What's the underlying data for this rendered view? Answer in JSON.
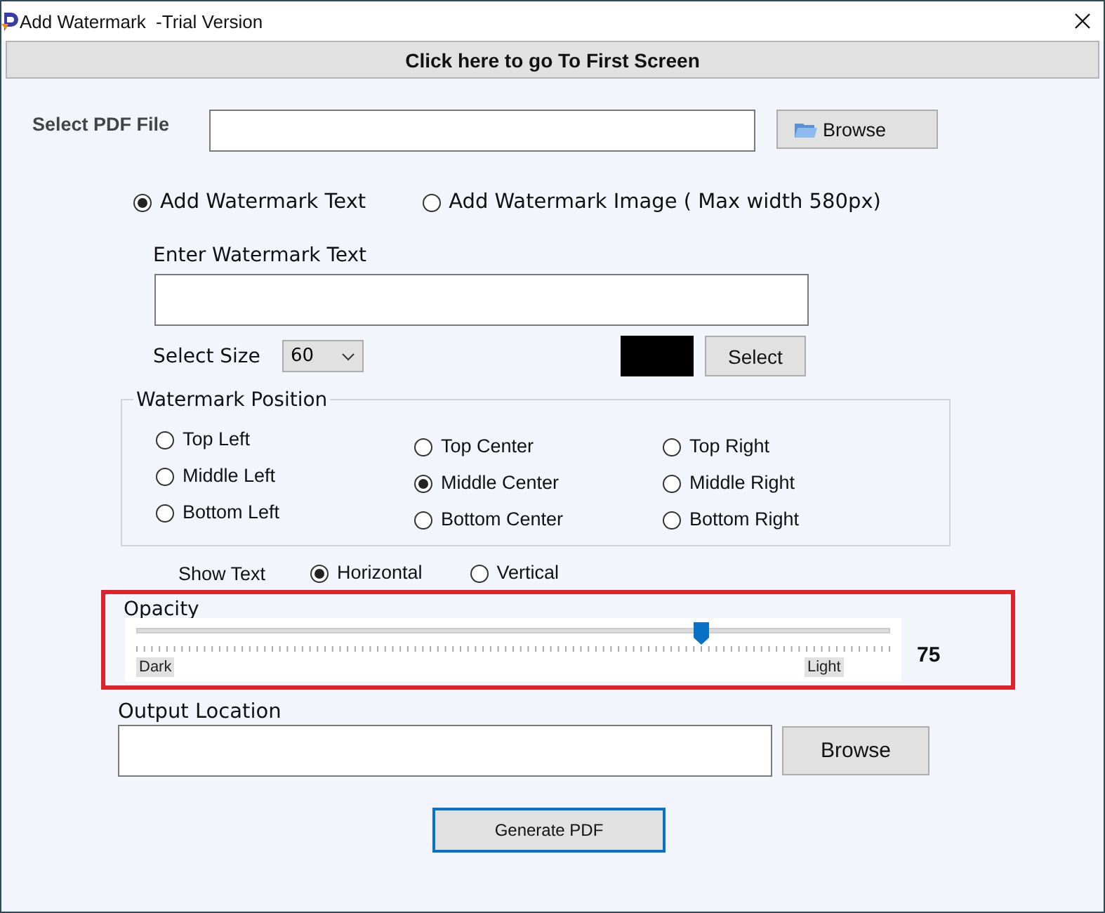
{
  "window": {
    "title": "Add Watermark",
    "subtitle": "-Trial Version"
  },
  "first_screen_button": "Click here to go To First Screen",
  "pdf_file": {
    "label": "Select PDF File",
    "button": "Browse"
  },
  "mode_options": [
    {
      "label": "Add Watermark Text",
      "selected": true
    },
    {
      "label": "Add Watermark Image ( Max width 580px)",
      "selected": false
    }
  ],
  "watermark_text": {
    "label": "Enter Watermark Text"
  },
  "size": {
    "label": "Select Size",
    "value": "60"
  },
  "text_color": {
    "color": "#000000",
    "button": "Select"
  },
  "position": {
    "legend": "Watermark Position",
    "columns": [
      {
        "options": [
          {
            "label": "Top Left",
            "selected": false
          },
          {
            "label": "Middle Left",
            "selected": false
          },
          {
            "label": "Bottom Left",
            "selected": false
          }
        ]
      },
      {
        "options": [
          {
            "label": "Top Center",
            "selected": false
          },
          {
            "label": "Middle Center",
            "selected": true
          },
          {
            "label": "Bottom Center",
            "selected": false
          }
        ]
      },
      {
        "options": [
          {
            "label": "Top Right",
            "selected": false
          },
          {
            "label": "Middle Right",
            "selected": false
          },
          {
            "label": "Bottom Right",
            "selected": false
          }
        ]
      }
    ]
  },
  "show_text": {
    "label": "Show Text",
    "options": [
      {
        "label": "Horizontal",
        "selected": true
      },
      {
        "label": "Vertical",
        "selected": false
      }
    ]
  },
  "opacity": {
    "label": "Opacity",
    "level": 0.75,
    "min_label": "Dark",
    "max_label": "Light",
    "reading": "75"
  },
  "output": {
    "label": "Output Location",
    "button": "Browse"
  },
  "generate_button": "Generate PDF"
}
